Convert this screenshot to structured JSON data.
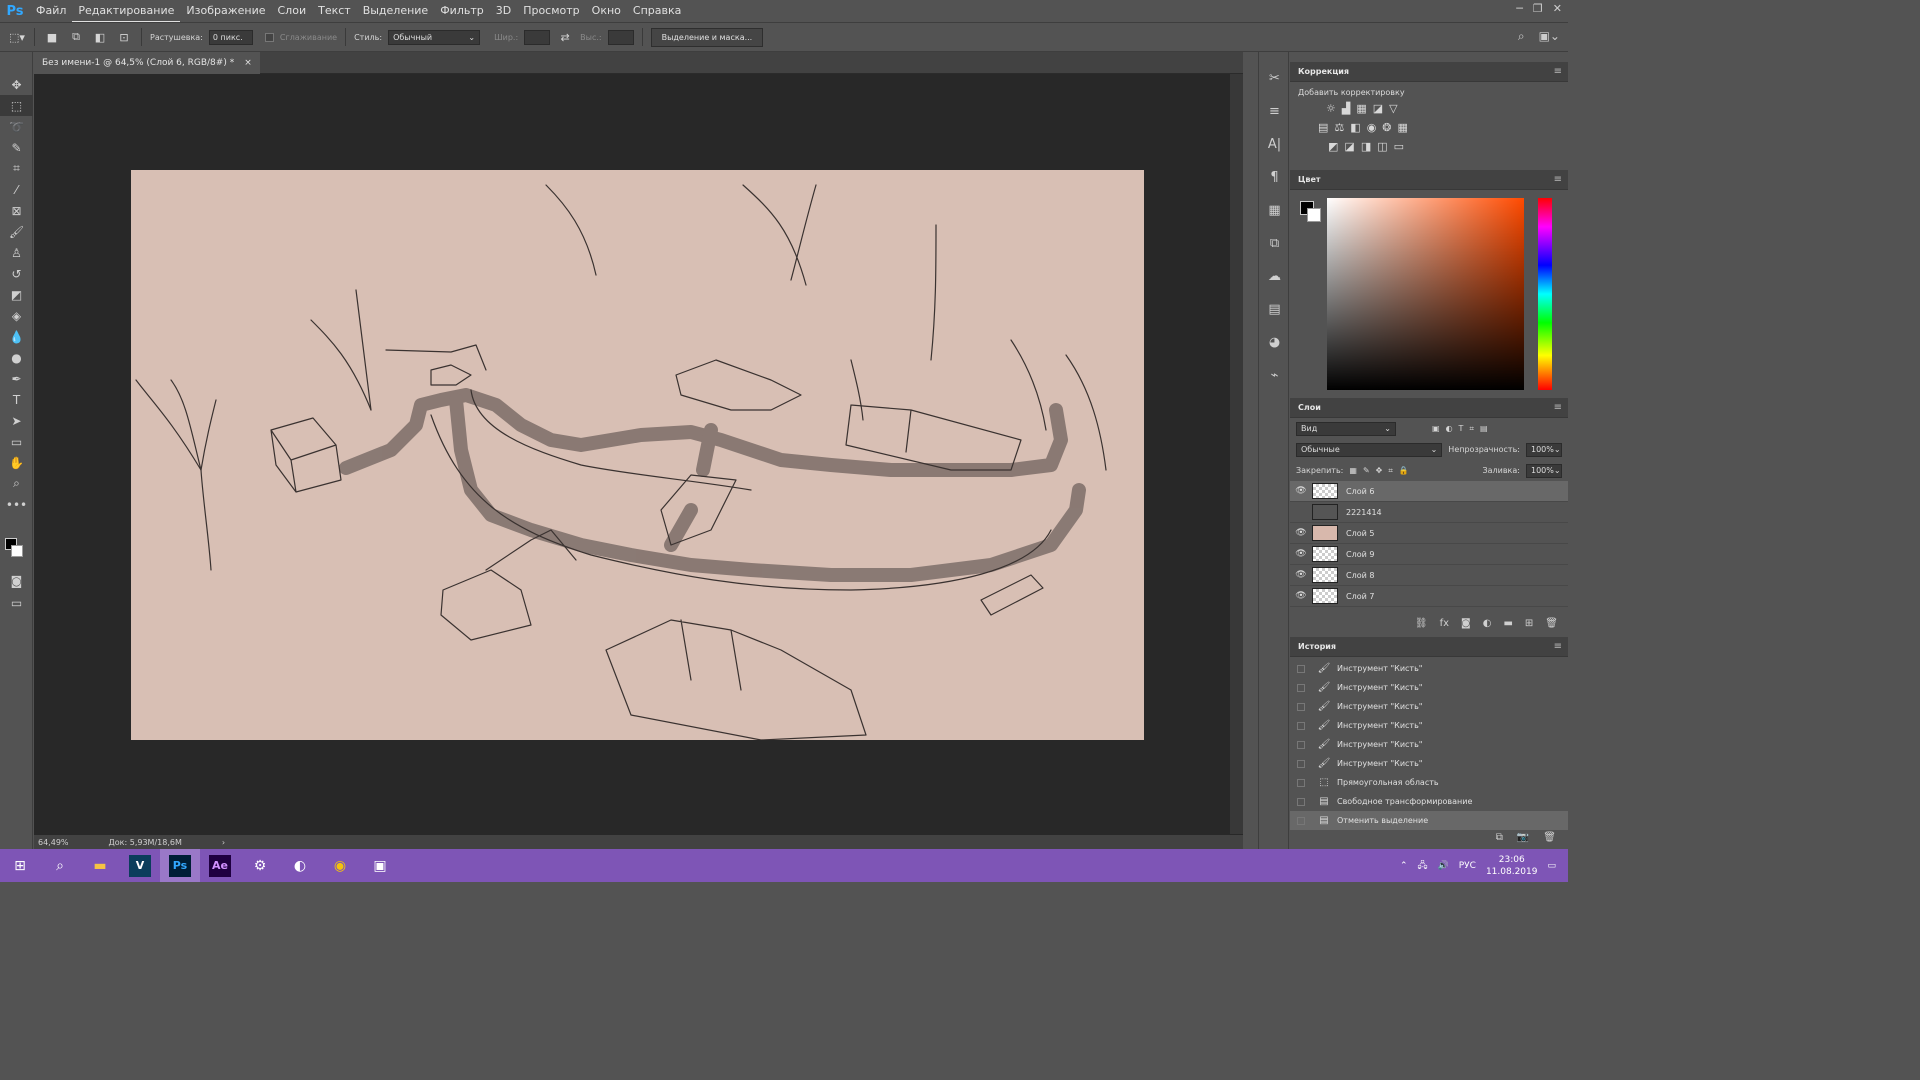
{
  "app": {
    "logo": "Ps"
  },
  "menu": [
    "Файл",
    "Редактирование",
    "Изображение",
    "Слои",
    "Текст",
    "Выделение",
    "Фильтр",
    "3D",
    "Просмотр",
    "Окно",
    "Справка"
  ],
  "options": {
    "feather_label": "Растушевка:",
    "feather_value": "0 пикс.",
    "antialias_label": "Сглаживание",
    "style_label": "Стиль:",
    "style_value": "Обычный",
    "width_label": "Шир.:",
    "height_label": "Выс.:",
    "select_mask_button": "Выделение и маска..."
  },
  "document": {
    "tab_title": "Без имени-1 @ 64,5% (Слой 6, RGB/8#) *",
    "tab_close": "×"
  },
  "status": {
    "zoom": "64,49%",
    "doc_size": "Док: 5,93M/18,6M",
    "arrow": "›"
  },
  "correction_panel": {
    "title": "Коррекция",
    "subtitle": "Добавить корректировку"
  },
  "color_panel": {
    "title": "Цвет"
  },
  "layers_panel": {
    "title": "Слои",
    "filter_label": "Вид",
    "blend_mode": "Обычные",
    "opacity_label": "Непрозрачность:",
    "opacity_value": "100%",
    "lock_label": "Закрепить:",
    "fill_label": "Заливка:",
    "fill_value": "100%",
    "layers": [
      {
        "name": "Слой 6",
        "visible": true,
        "selected": true,
        "thumb": "transparent"
      },
      {
        "name": "2221414",
        "visible": false,
        "selected": false,
        "thumb": "dark"
      },
      {
        "name": "Слой 5",
        "visible": true,
        "selected": false,
        "thumb": "pink"
      },
      {
        "name": "Слой 9",
        "visible": true,
        "selected": false,
        "thumb": "transparent"
      },
      {
        "name": "Слой 8",
        "visible": true,
        "selected": false,
        "thumb": "transparent"
      },
      {
        "name": "Слой 7",
        "visible": true,
        "selected": false,
        "thumb": "transparent"
      }
    ]
  },
  "history_panel": {
    "title": "История",
    "items": [
      "Инструмент \"Кисть\"",
      "Инструмент \"Кисть\"",
      "Инструмент \"Кисть\"",
      "Инструмент \"Кисть\"",
      "Инструмент \"Кисть\"",
      "Инструмент \"Кисть\"",
      "Прямоугольная область",
      "Свободное трансформирование",
      "Отменить выделение"
    ]
  },
  "taskbar": {
    "apps": [
      "V",
      "Ps",
      "Ae"
    ],
    "lang": "РУС",
    "time": "23:06",
    "date": "11.08.2019"
  },
  "colors": {
    "canvas": "#d8bfb4",
    "taskbar": "#7e55b6",
    "accent": "#31a8ff"
  }
}
